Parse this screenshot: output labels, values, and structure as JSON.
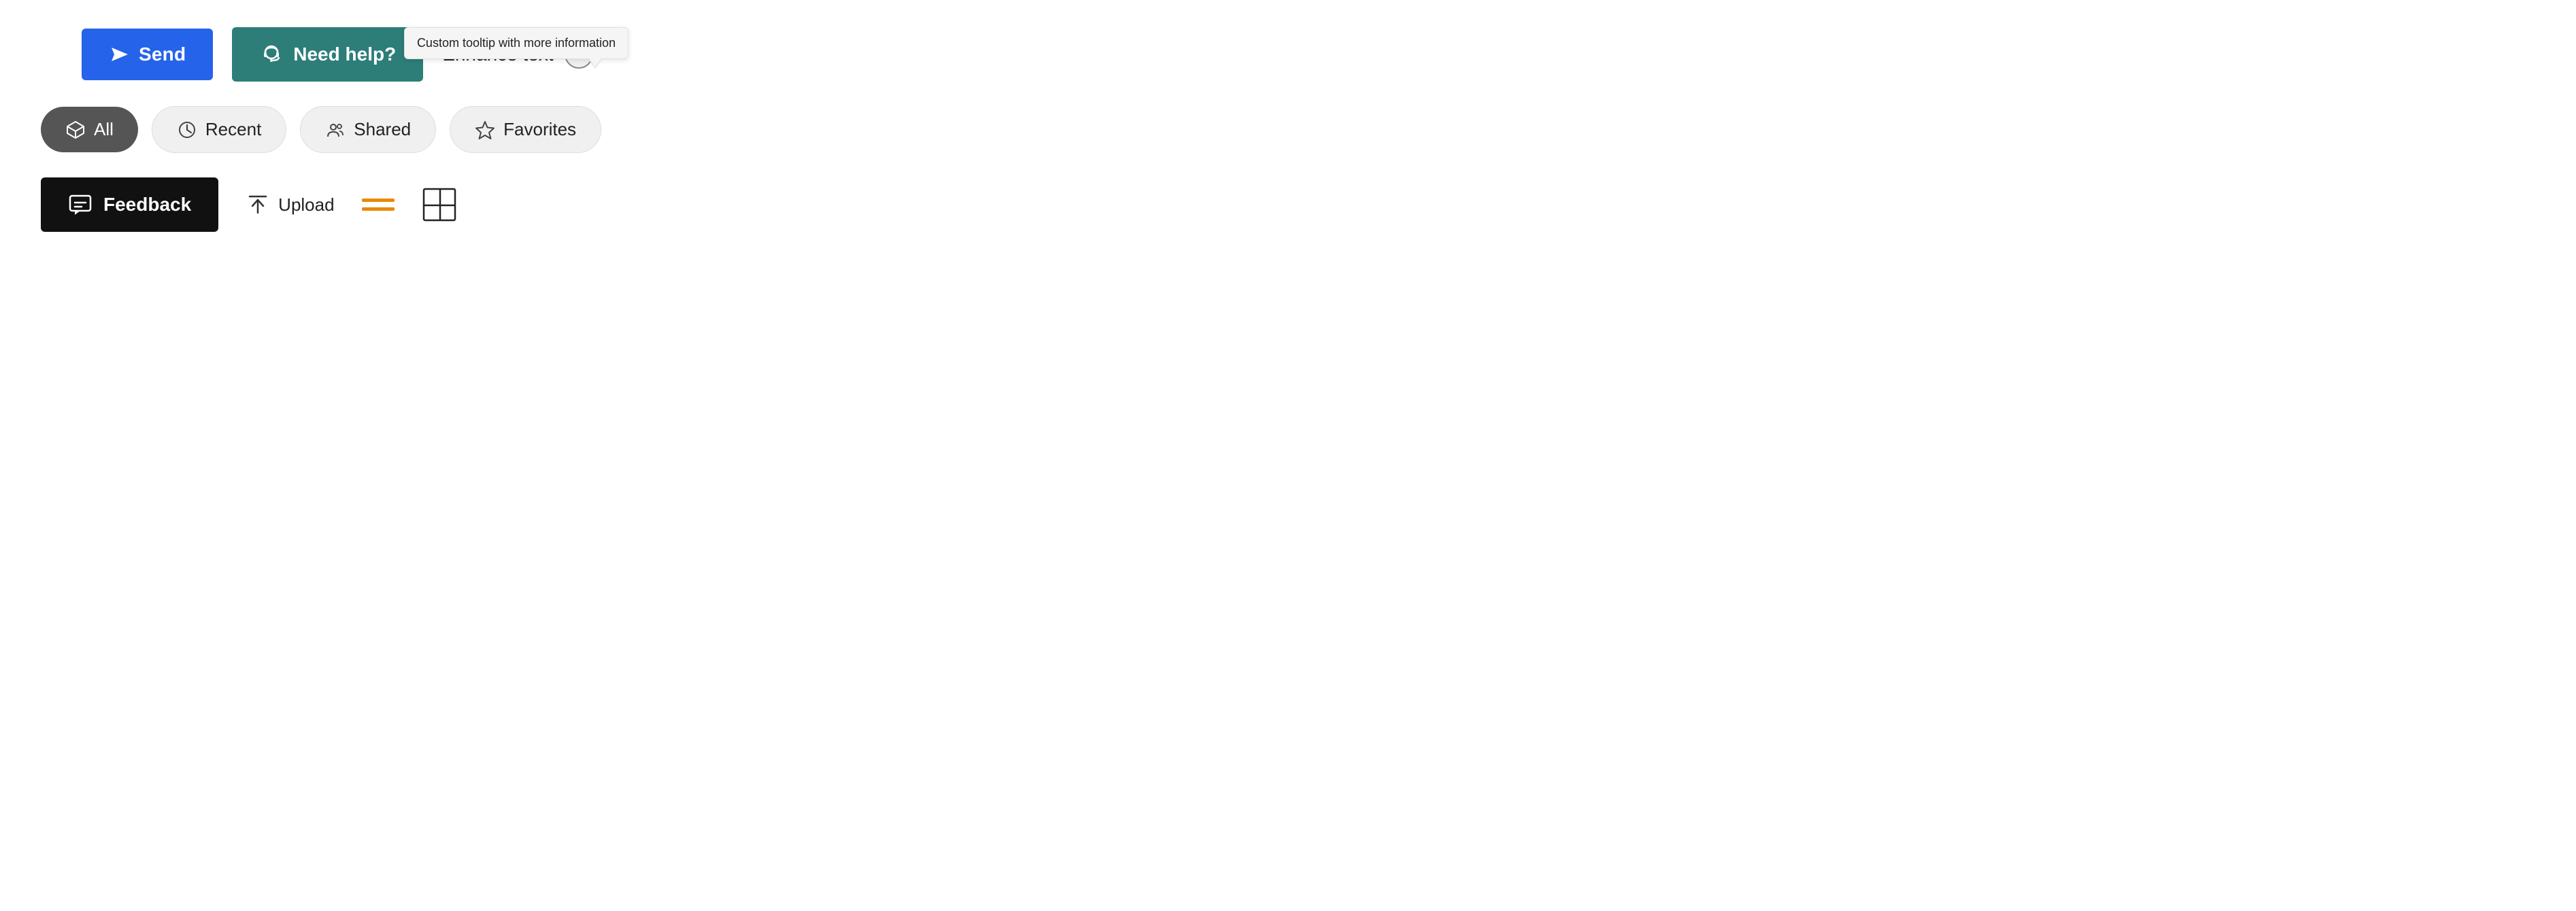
{
  "tooltip": {
    "text": "Custom tooltip with more information"
  },
  "row1": {
    "send_label": "Send",
    "need_help_label": "Need help?",
    "enhance_label": "Enhance text",
    "info_icon": "i"
  },
  "row2": {
    "pills": [
      {
        "id": "all",
        "label": "All",
        "active": true,
        "icon": "cube-icon"
      },
      {
        "id": "recent",
        "label": "Recent",
        "active": false,
        "icon": "clock-icon"
      },
      {
        "id": "shared",
        "label": "Shared",
        "active": false,
        "icon": "people-icon"
      },
      {
        "id": "favorites",
        "label": "Favorites",
        "active": false,
        "icon": "star-icon"
      }
    ]
  },
  "row3": {
    "feedback_label": "Feedback",
    "upload_label": "Upload",
    "list_icon": "list-icon",
    "grid_icon": "grid-icon"
  }
}
